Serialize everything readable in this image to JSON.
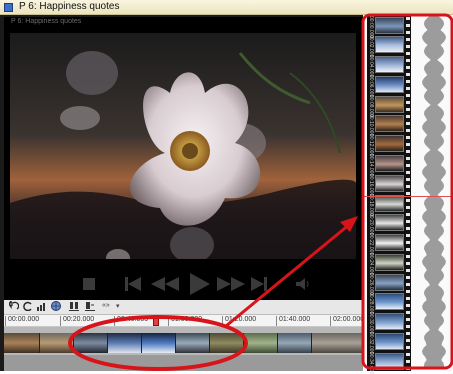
{
  "window": {
    "title": "P 6: Happiness quotes"
  },
  "player": {
    "overlay_title": "P 6: Happiness quotes",
    "controls": [
      {
        "name": "stop-button",
        "icon": "stop-icon"
      },
      {
        "name": "go-to-start-button",
        "icon": "skip-back-icon"
      },
      {
        "name": "rewind-button",
        "icon": "rewind-icon"
      },
      {
        "name": "play-button",
        "icon": "play-icon"
      },
      {
        "name": "fast-forward-button",
        "icon": "fast-forward-icon"
      },
      {
        "name": "go-to-end-button",
        "icon": "skip-forward-icon"
      },
      {
        "name": "volume-button",
        "icon": "speaker-icon"
      }
    ]
  },
  "toolbar": {
    "quote_label": "«»",
    "dropdown_label": "▾"
  },
  "ruler": {
    "ticks": [
      "00:00.000",
      "00:20.000",
      "00:40.000",
      "01:00.000",
      "01:20.000",
      "01:40.000",
      "02:00.000"
    ]
  },
  "filmstrip": {
    "timecodes": [
      "00:00.000",
      "00:02.000",
      "00:04.000",
      "00:06.000",
      "00:08.000",
      "00:10.000",
      "00:12.000",
      "00:14.000",
      "00:16.000",
      "00:18.000",
      "00:20.000",
      "00:22.000",
      "00:24.000",
      "00:26.000",
      "00:28.000",
      "00:30.000",
      "00:32.000",
      "00:34.000"
    ]
  },
  "colors": {
    "title_bar": "#ece4bf",
    "annotation_red": "#d8141b",
    "timeline_bg": "#b8b8b8"
  }
}
